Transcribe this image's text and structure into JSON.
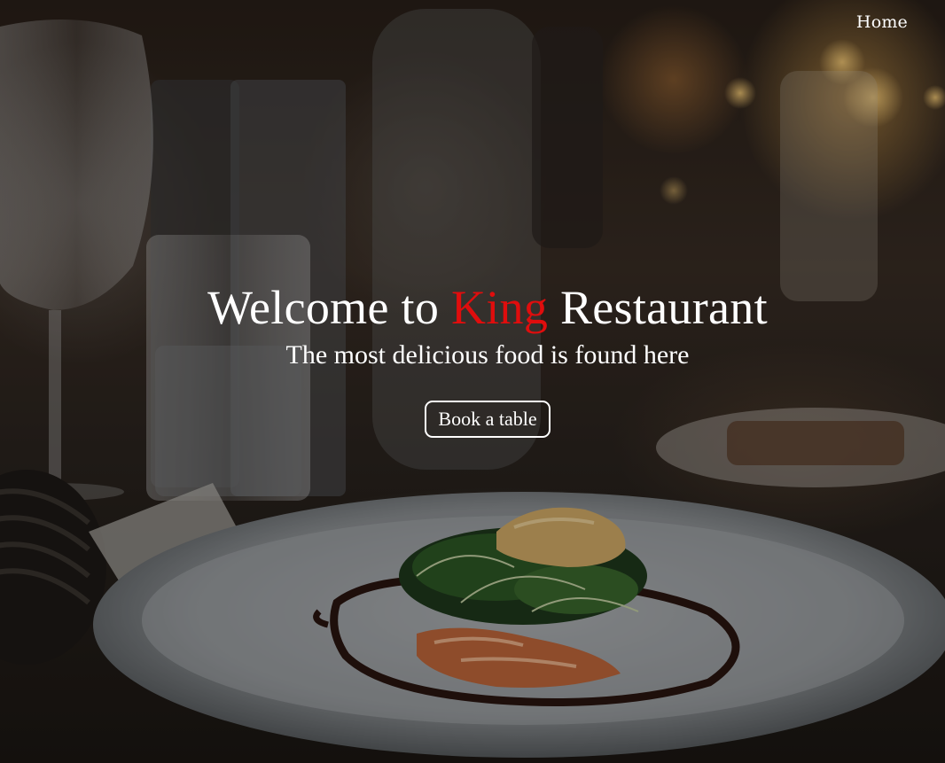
{
  "nav": {
    "home_label": "Home"
  },
  "hero": {
    "title_prefix": "Welcome to ",
    "title_accent": "King",
    "title_suffix": " Restaurant",
    "subtitle": "The most delicious food is found here",
    "cta_label": "Book a table"
  },
  "colors": {
    "accent": "#e00d0d",
    "text": "#ffffff"
  },
  "background": {
    "image_icon": "restaurant-table-photo-icon"
  }
}
